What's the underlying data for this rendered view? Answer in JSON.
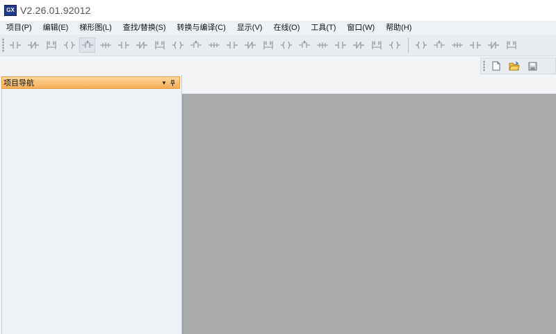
{
  "app": {
    "title": "V2.26.01.92012",
    "logo_text": "GX"
  },
  "menu": [
    {
      "label": "项目(P)"
    },
    {
      "label": "编辑(E)"
    },
    {
      "label": "梯形图(L)"
    },
    {
      "label": "查找/替换(S)"
    },
    {
      "label": "转换与编译(C)"
    },
    {
      "label": "显示(V)"
    },
    {
      "label": "在线(O)"
    },
    {
      "label": "工具(T)"
    },
    {
      "label": "窗口(W)"
    },
    {
      "label": "帮助(H)"
    }
  ],
  "ladder_toolbar": {
    "group1": [
      {
        "icon": "contact-no-icon"
      },
      {
        "icon": "contact-nc-icon"
      },
      {
        "icon": "parallel-no-icon"
      },
      {
        "icon": "parallel-nc-icon"
      },
      {
        "icon": "coil-icon"
      },
      {
        "icon": "function-icon"
      },
      {
        "icon": "function-parallel-icon"
      },
      {
        "icon": "invert-icon"
      },
      {
        "icon": "rising-edge-icon"
      },
      {
        "icon": "falling-edge-icon"
      },
      {
        "icon": "rising-edge-parallel-icon"
      },
      {
        "icon": "falling-edge-parallel-icon"
      },
      {
        "icon": "pulse-icon"
      },
      {
        "icon": "pulse-neg-icon"
      },
      {
        "icon": "hline-icon"
      },
      {
        "icon": "vline-icon"
      },
      {
        "icon": "delete-hline-icon"
      },
      {
        "icon": "delete-vline-icon"
      },
      {
        "icon": "pulse-contact-icon"
      },
      {
        "icon": "pulse-contact-nc-icon"
      },
      {
        "icon": "pulse-contact-parallel-icon"
      },
      {
        "icon": "pulse-contact-nc-parallel-icon"
      }
    ],
    "group2": [
      {
        "icon": "operation-result-rise-icon"
      },
      {
        "icon": "operation-result-fall-icon"
      },
      {
        "icon": "operation-result-rise-parallel-icon"
      },
      {
        "icon": "operation-result-fall-parallel-icon"
      },
      {
        "icon": "operation-result-pulse-icon"
      },
      {
        "icon": "operation-result-pulse-neg-icon"
      }
    ]
  },
  "file_toolbar": [
    {
      "icon": "new-file-icon"
    },
    {
      "icon": "open-folder-icon"
    },
    {
      "icon": "save-icon"
    }
  ],
  "nav_panel": {
    "title": "项目导航",
    "dropdown_icon": "dropdown-triangle-icon",
    "pin_icon": "pin-icon"
  },
  "colors": {
    "nav_header_top": "#ffd59a",
    "nav_header_bottom": "#f6ad58",
    "workspace": "#ababab",
    "panel_bg": "#eef1f6"
  }
}
